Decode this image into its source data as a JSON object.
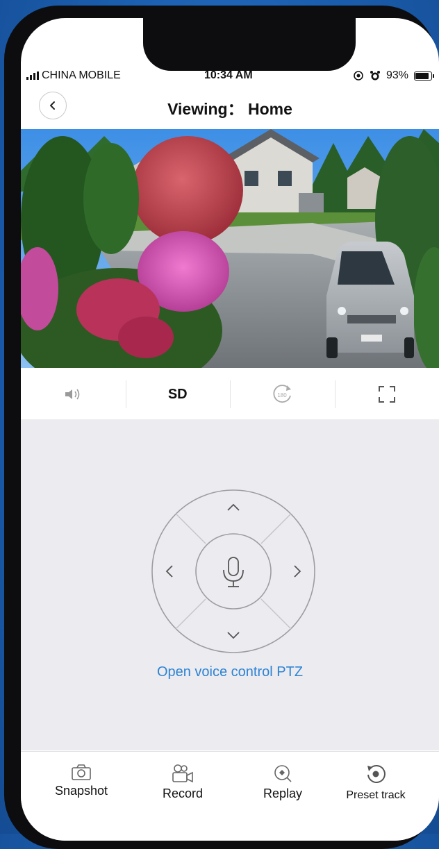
{
  "status_bar": {
    "carrier": "CHINA MOBILE",
    "time": "10:34 AM",
    "battery": "93%",
    "battery_level": 0.93
  },
  "header": {
    "back_icon": "chevron-left-icon",
    "title": "Viewing： Home"
  },
  "toolbar": {
    "items": [
      {
        "icon": "speaker-icon"
      },
      {
        "label": "SD"
      },
      {
        "icon": "rotate-180-icon"
      },
      {
        "icon": "fullscreen-icon"
      }
    ]
  },
  "ptz": {
    "center_icon": "microphone-icon",
    "voice_link": "Open voice control PTZ"
  },
  "bottom_nav": [
    {
      "icon": "camera-icon",
      "label": "Snapshot"
    },
    {
      "icon": "video-camera-icon",
      "label": "Record"
    },
    {
      "icon": "replay-icon",
      "label": "Replay"
    },
    {
      "icon": "preset-track-icon",
      "label": "Preset track"
    }
  ],
  "colors": {
    "accent": "#2b83d3",
    "control_bg": "#ecebf0",
    "background": "#1b5fb0"
  }
}
